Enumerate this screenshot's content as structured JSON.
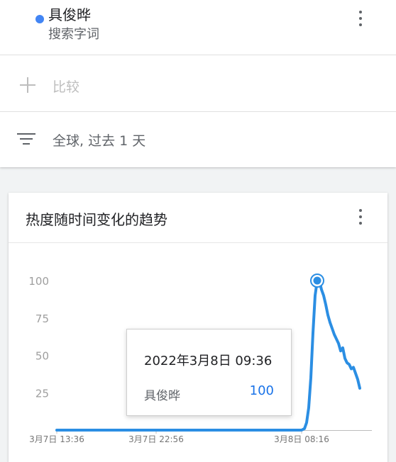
{
  "search_term": {
    "name": "具俊晔",
    "type": "搜索字词",
    "color": "#4285f4"
  },
  "compare": {
    "label": "比较"
  },
  "filter": {
    "label": "全球, 过去 1 天"
  },
  "chart_section": {
    "title": "热度随时间变化的趋势"
  },
  "tooltip": {
    "date": "2022年3月8日 09:36",
    "term": "具俊晔",
    "value": "100"
  },
  "chart_data": {
    "type": "line",
    "title": "热度随时间变化的趋势",
    "xlabel": "",
    "ylabel": "",
    "ylim": [
      0,
      100
    ],
    "y_ticks": [
      25,
      50,
      75,
      100
    ],
    "x_tick_labels": [
      "3月7日 13:36",
      "3月7日 22:56",
      "3月8日 08:16"
    ],
    "grid": false,
    "series": [
      {
        "name": "具俊晔",
        "color": "#2b8ee3",
        "points": [
          [
            0,
            0
          ],
          [
            70,
            0
          ],
          [
            140,
            0
          ],
          [
            210,
            0
          ],
          [
            280,
            0
          ],
          [
            345,
            0
          ],
          [
            349,
            1
          ],
          [
            352,
            5
          ],
          [
            355,
            15
          ],
          [
            358,
            35
          ],
          [
            361,
            65
          ],
          [
            364,
            90
          ],
          [
            367,
            100
          ],
          [
            370,
            100
          ],
          [
            373,
            94
          ],
          [
            376,
            90
          ],
          [
            379,
            84
          ],
          [
            382,
            77
          ],
          [
            385,
            72
          ],
          [
            388,
            68
          ],
          [
            391,
            64
          ],
          [
            394,
            61
          ],
          [
            397,
            58
          ],
          [
            400,
            53
          ],
          [
            403,
            55
          ],
          [
            406,
            48
          ],
          [
            409,
            45
          ],
          [
            412,
            44
          ],
          [
            415,
            41
          ],
          [
            418,
            42
          ],
          [
            421,
            38
          ],
          [
            424,
            34
          ],
          [
            427,
            28
          ]
        ],
        "highlight_index": 12
      }
    ]
  }
}
